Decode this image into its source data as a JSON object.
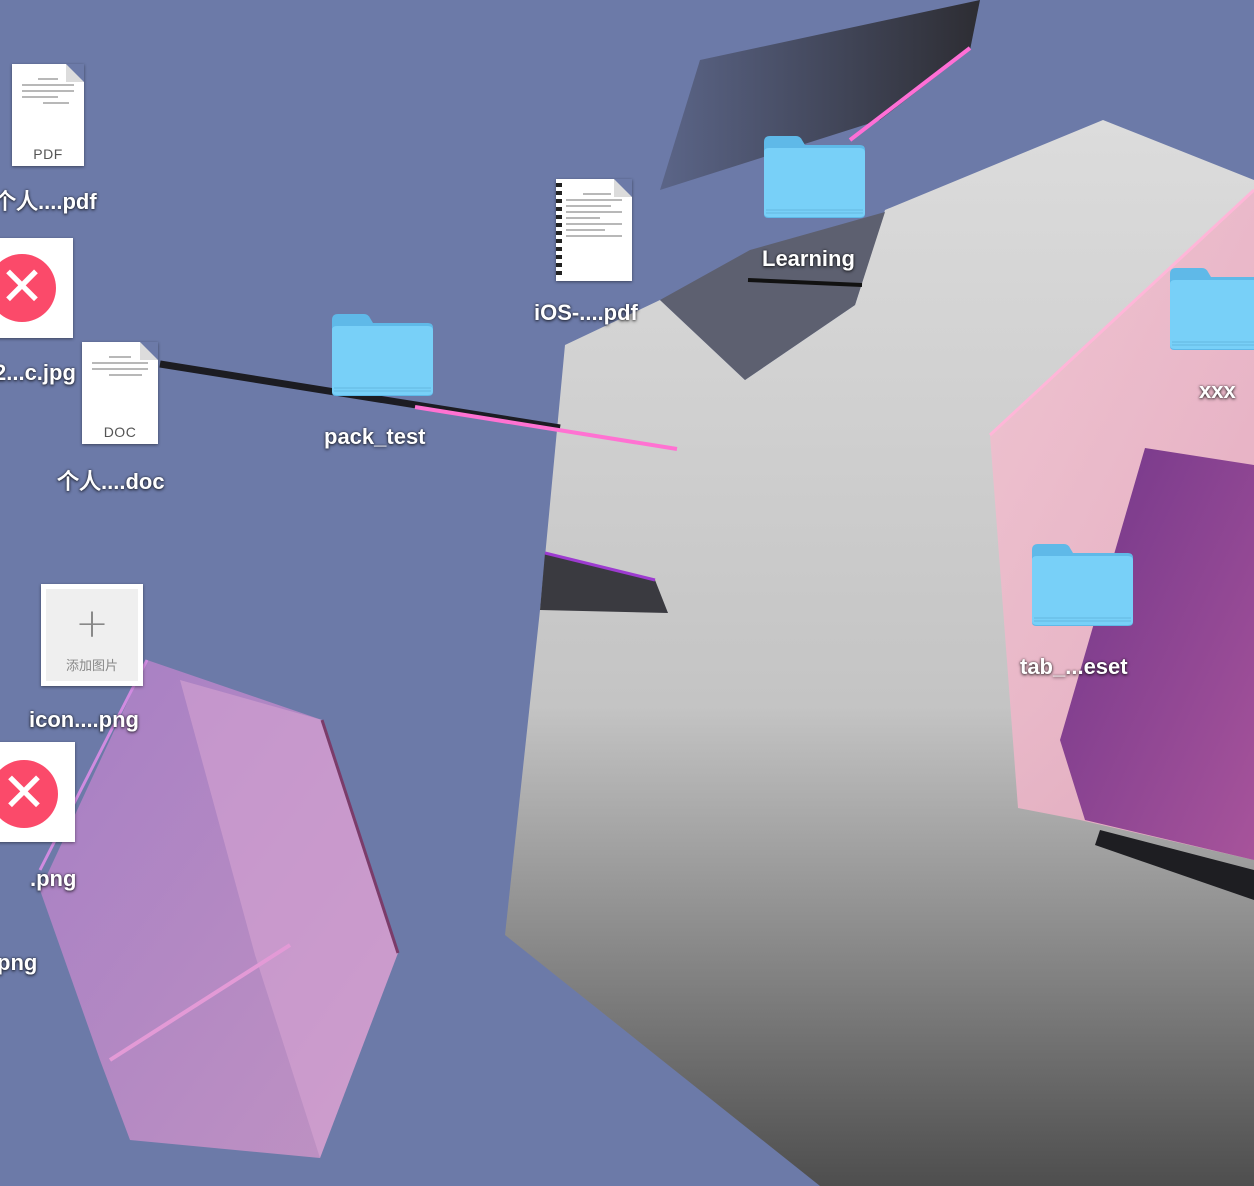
{
  "desktop": {
    "icons": [
      {
        "name": "个人....pdf",
        "kind": "PDF"
      },
      {
        "name": "2...c.jpg"
      },
      {
        "name": "个人....doc",
        "kind": "DOC"
      },
      {
        "name": "icon....png",
        "placeholder": "添加图片"
      },
      {
        "name": ".png"
      },
      {
        "name": "png"
      },
      {
        "name": "pack_test"
      },
      {
        "name": "iOS-....pdf"
      },
      {
        "name": "Learning"
      },
      {
        "name": "xxx"
      },
      {
        "name": "tab_...eset"
      }
    ]
  },
  "colors": {
    "wallpaper": "#6c7aa8",
    "folder": "#6ecdf7",
    "error_badge": "#fb4a6a"
  }
}
